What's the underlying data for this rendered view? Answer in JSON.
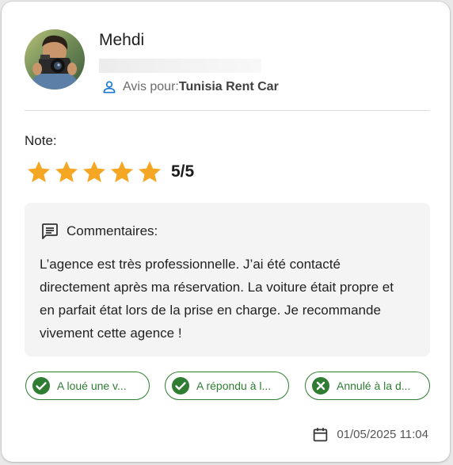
{
  "review": {
    "user_name": "Mehdi",
    "review_for_label": "Avis pour:",
    "agency_name": "Tunisia Rent Car",
    "rating_label": "Note:",
    "rating_value": 5,
    "rating_max": 5,
    "rating_text": "5/5",
    "comment_label": "Commentaires:",
    "comment_text": "L’agence est très professionnelle. J’ai été contacté directement après ma réservation. La voiture était propre et en parfait état lors de la prise en charge. Je recommande vivement cette agence !",
    "tags": [
      {
        "label": "A loué une v...",
        "icon": "check-circle-icon"
      },
      {
        "label": "A répondu à l...",
        "icon": "check-circle-icon"
      },
      {
        "label": "Annulé à la d...",
        "icon": "cancel-circle-icon"
      }
    ],
    "date": "01/05/2025 11:04"
  },
  "colors": {
    "star": "#f5a623",
    "tag_green": "#2e7d32",
    "person_icon": "#1976d2",
    "comment_bg": "#f4f4f4"
  }
}
